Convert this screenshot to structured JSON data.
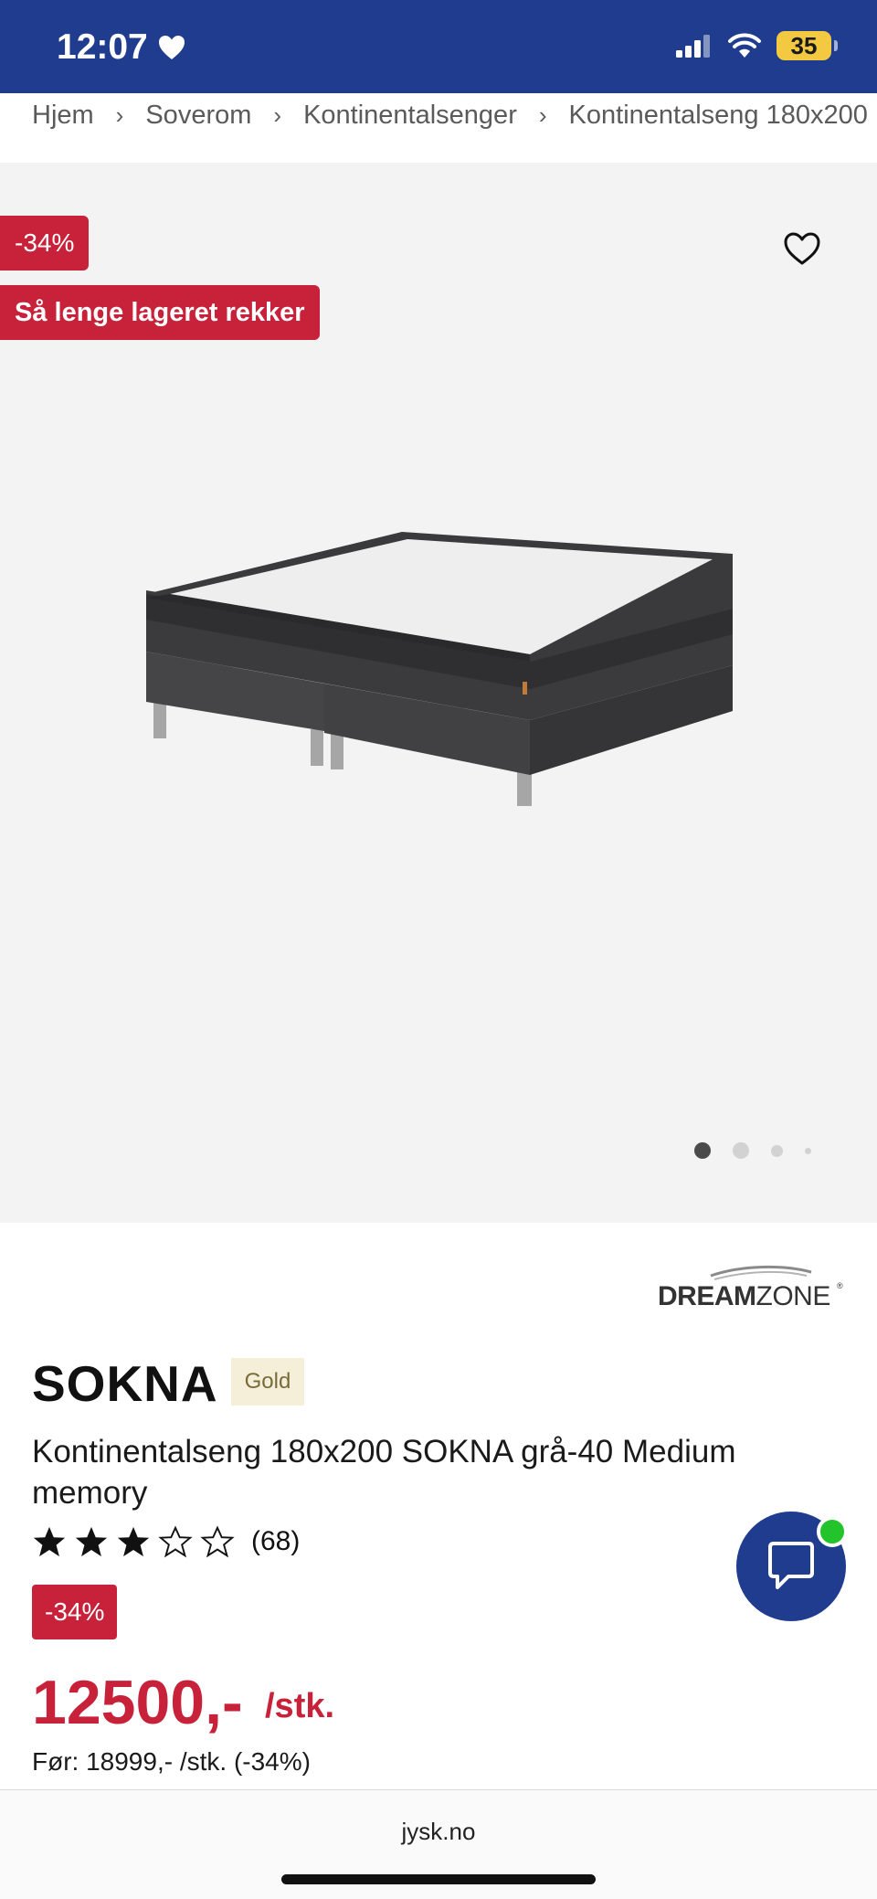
{
  "status_bar": {
    "time": "12:07",
    "battery": "35",
    "bg_color": "#1f3c8f"
  },
  "breadcrumb": [
    "Hjem",
    "Soverom",
    "Kontinentalsenger",
    "Kontinentalseng 180x200"
  ],
  "gallery": {
    "discount_badge": "-34%",
    "stock_badge": "Så lenge lageret rekker",
    "favorite_icon": "heart-outline-icon",
    "active_dot": 1,
    "dot_count": 4
  },
  "product": {
    "brand_logo": "DREAMZONE",
    "name": "SOKNA",
    "tier": "Gold",
    "description": "Kontinentalseng 180x200 SOKNA grå-40 Medium memory",
    "rating": 3,
    "rating_max": 5,
    "rating_count": "(68)",
    "discount_badge": "-34%",
    "price": "12500,-",
    "unit": "/stk.",
    "before_price": "Før: 18999,- /stk. (-34%)",
    "accent_color": "#c7223a"
  },
  "chat": {
    "icon": "chat-bubble-icon",
    "online": true
  },
  "browser": {
    "url": "jysk.no"
  }
}
